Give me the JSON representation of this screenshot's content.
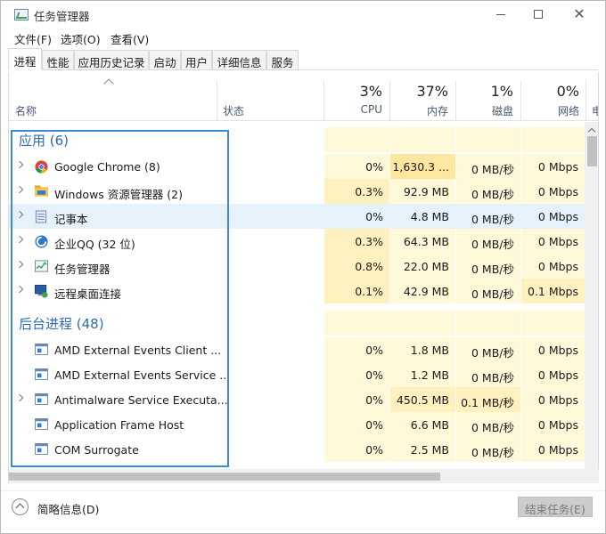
{
  "window": {
    "title": "任务管理器"
  },
  "menu": [
    "文件(F)",
    "选项(O)",
    "查看(V)"
  ],
  "tabs": [
    "进程",
    "性能",
    "应用历史记录",
    "启动",
    "用户",
    "详细信息",
    "服务"
  ],
  "active_tab": "进程",
  "columns": {
    "name": "名称",
    "status": "状态",
    "cpu": {
      "label": "CPU",
      "pct": "3%"
    },
    "memory": {
      "label": "内存",
      "pct": "37%"
    },
    "disk": {
      "label": "磁盘",
      "pct": "1%"
    },
    "network": {
      "label": "网络",
      "pct": "0%"
    },
    "more": "电"
  },
  "groups": {
    "apps": "应用 (6)",
    "background": "后台进程 (48)"
  },
  "apps": [
    {
      "name": "Google Chrome (8)",
      "icon": "chrome-icon",
      "cpu": "0%",
      "memory": "1,630.3 ...",
      "disk": "0 MB/秒",
      "network": "0 Mbps"
    },
    {
      "name": "Windows 资源管理器 (2)",
      "icon": "explorer-icon",
      "cpu": "0.3%",
      "memory": "92.9 MB",
      "disk": "0 MB/秒",
      "network": "0 Mbps"
    },
    {
      "name": "记事本",
      "icon": "notepad-icon",
      "cpu": "0%",
      "memory": "4.8 MB",
      "disk": "0 MB/秒",
      "network": "0 Mbps"
    },
    {
      "name": "企业QQ (32 位)",
      "icon": "qq-icon",
      "cpu": "0.3%",
      "memory": "64.3 MB",
      "disk": "0 MB/秒",
      "network": "0 Mbps"
    },
    {
      "name": "任务管理器",
      "icon": "task-manager-icon",
      "cpu": "0.8%",
      "memory": "22.0 MB",
      "disk": "0 MB/秒",
      "network": "0 Mbps"
    },
    {
      "name": "远程桌面连接",
      "icon": "remote-desktop-icon",
      "cpu": "0.1%",
      "memory": "42.9 MB",
      "disk": "0 MB/秒",
      "network": "0.1 Mbps"
    }
  ],
  "background": [
    {
      "name": "AMD External Events Client ...",
      "cpu": "0%",
      "memory": "1.8 MB",
      "disk": "0 MB/秒",
      "network": "0 Mbps"
    },
    {
      "name": "AMD External Events Service ...",
      "cpu": "0%",
      "memory": "1.2 MB",
      "disk": "0 MB/秒",
      "network": "0 Mbps"
    },
    {
      "name": "Antimalware Service Executa...",
      "cpu": "0%",
      "memory": "450.5 MB",
      "disk": "0.1 MB/秒",
      "network": "0 Mbps"
    },
    {
      "name": "Application Frame Host",
      "cpu": "0%",
      "memory": "6.6 MB",
      "disk": "0 MB/秒",
      "network": "0 Mbps"
    },
    {
      "name": "COM Surrogate",
      "cpu": "0%",
      "memory": "2.5 MB",
      "disk": "0 MB/秒",
      "network": "0 Mbps"
    }
  ],
  "footer": {
    "fewer_details": "简略信息(D)",
    "end_task": "结束任务(E)"
  },
  "colors": {
    "heat_light": "#fff8d9",
    "heat_mid": "#fff1bf",
    "heat_strong": "#ffe7a0",
    "group_text": "#2e6bb1",
    "highlight": "#3c8ad5"
  }
}
